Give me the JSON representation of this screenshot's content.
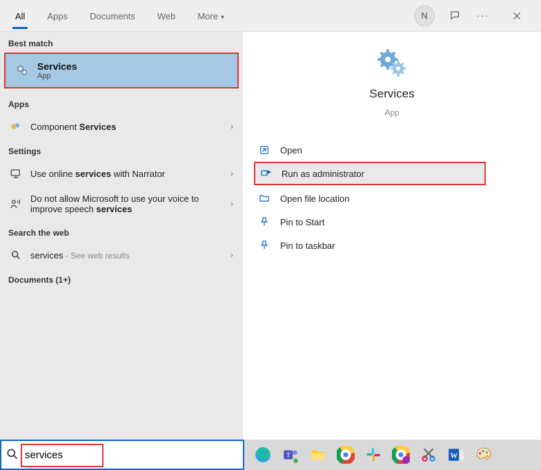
{
  "tabs": {
    "all": "All",
    "apps": "Apps",
    "documents": "Documents",
    "web": "Web",
    "more": "More"
  },
  "header": {
    "avatar_initial": "N"
  },
  "left": {
    "best_match_label": "Best match",
    "best_match": {
      "title": "Services",
      "sub": "App"
    },
    "apps_label": "Apps",
    "apps_item_prefix": "Component ",
    "apps_item_bold": "Services",
    "settings_label": "Settings",
    "setting1_pre": "Use online ",
    "setting1_bold": "services",
    "setting1_post": " with Narrator",
    "setting2_pre": "Do not allow Microsoft to use your voice to improve speech ",
    "setting2_bold": "services",
    "web_label": "Search the web",
    "web_item": "services",
    "web_sub": " - See web results",
    "documents_label": "Documents (1+)"
  },
  "preview": {
    "title": "Services",
    "sub": "App",
    "actions": {
      "open": "Open",
      "run_admin": "Run as administrator",
      "open_loc": "Open file location",
      "pin_start": "Pin to Start",
      "pin_taskbar": "Pin to taskbar"
    }
  },
  "search": {
    "value": "services"
  },
  "tray_icons": [
    "edge",
    "teams",
    "explorer",
    "chrome",
    "slack",
    "chrome2",
    "paint3d",
    "word",
    "paint"
  ]
}
